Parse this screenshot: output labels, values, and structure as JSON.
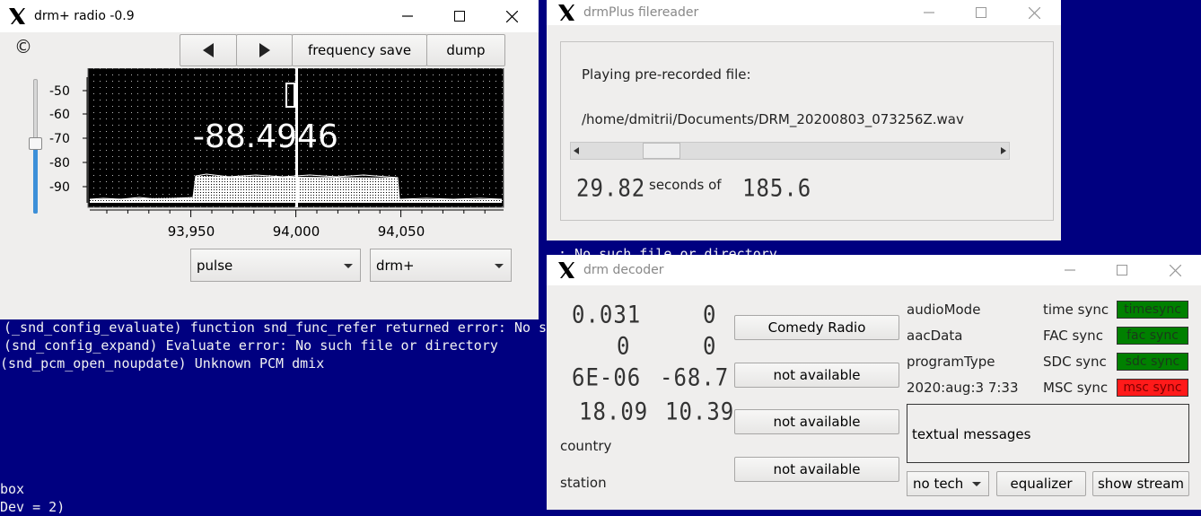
{
  "terminal": {
    "lines": [
      "(_snd_config_evaluate) function snd_func_refer returned error: No su",
      "(snd_config_expand) Evaluate error: No such file or directory",
      "(snd_pcm_open_noupdate) Unknown PCM dmix",
      "box",
      "Dev = 2)",
      ": No such file or directory"
    ]
  },
  "radio": {
    "title": "drm+ radio -0.9",
    "copyright": "©",
    "prev_icon": "triangle-left-icon",
    "next_icon": "triangle-right-icon",
    "frequency_save_label": "frequency save",
    "dump_label": "dump",
    "y_ticks": [
      "-50",
      "-60",
      "-70",
      "-80",
      "-90"
    ],
    "x_ticks": [
      "93,950",
      "94,000",
      "94,050"
    ],
    "frequency_display": "-88.4946",
    "volume_level": 0.52,
    "device_select": "pulse",
    "mode_select": "drm+"
  },
  "filereader": {
    "title": "drmPlus filereader",
    "playing_label": "Playing pre-recorded file:",
    "file_path": "/home/dmitrii/Documents/DRM_20200803_073256Z.wav",
    "seconds_played": "29.82",
    "seconds_of_label": "seconds of",
    "total_seconds": "185.6",
    "scroll_position": 0.16
  },
  "decoder": {
    "title": "drm decoder",
    "lcd_left": [
      "0.031",
      "0",
      "6E-06",
      "18.09"
    ],
    "lcd_right": [
      "0",
      "0",
      "-68.7",
      "10.39"
    ],
    "country_label": "country",
    "station_label": "station",
    "service_buttons": [
      "Comedy Radio",
      "not available",
      "not available",
      "not available"
    ],
    "info": [
      "audioMode",
      "aacData",
      "programType",
      "2020:aug:3 7:33"
    ],
    "sync_labels": [
      "time sync",
      "FAC sync",
      "SDC sync",
      "MSC sync"
    ],
    "sync_states": [
      "timesync",
      "fac  sync",
      "sdc sync",
      "msc sync"
    ],
    "sync_colors": [
      "#008000",
      "#008000",
      "#008000",
      "#ff1a1a"
    ],
    "textual_messages": "textual messages",
    "tech_select": "no tech",
    "equalizer_label": "equalizer",
    "show_stream_label": "show stream"
  }
}
